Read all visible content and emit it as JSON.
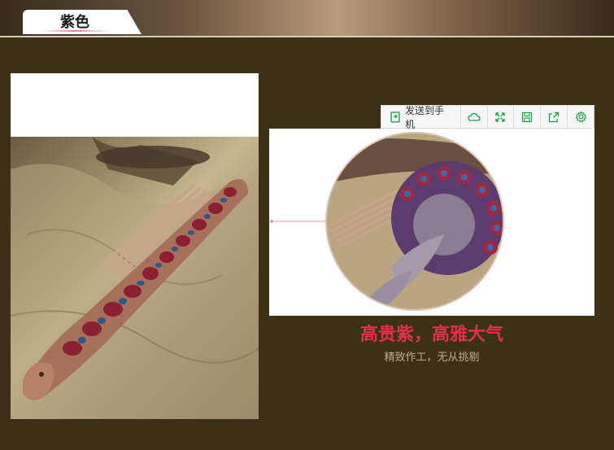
{
  "header": {
    "tab_title": "紫色"
  },
  "toolbar": {
    "send_to_phone": "发送到手机",
    "buttons": [
      "cloud-icon",
      "expand-icon",
      "save-icon",
      "share-icon",
      "settings-icon"
    ]
  },
  "caption": {
    "headline": "高贵紫，高雅大气",
    "subline": "精致作工，无从挑剔"
  },
  "colors": {
    "background": "#3a3116",
    "headline": "#e0304a",
    "subline": "#b8ad95",
    "toolbar_icon": "#1aa34a"
  }
}
